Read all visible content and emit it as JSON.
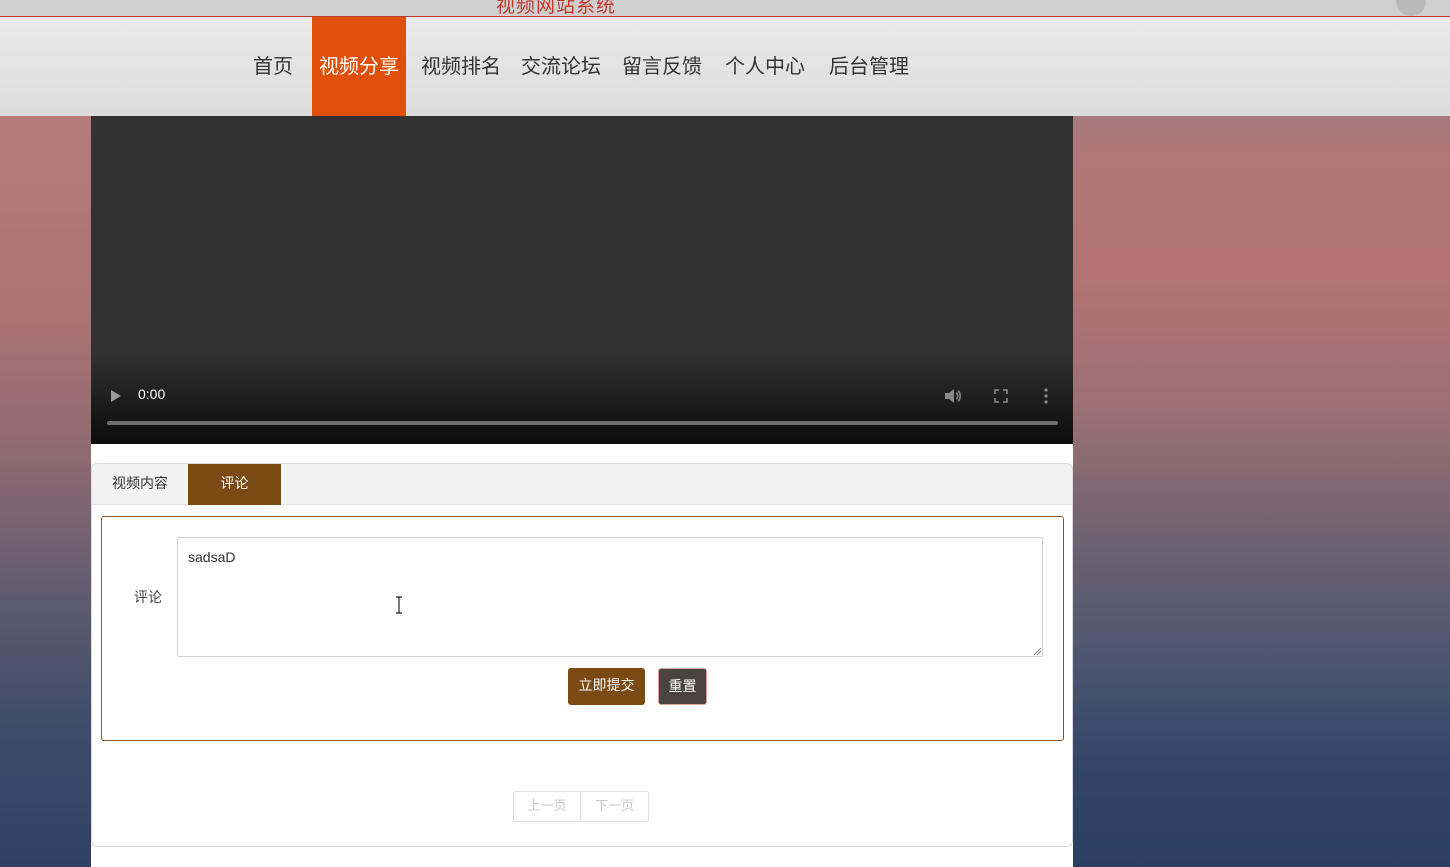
{
  "header": {
    "site_title": "视频网站系统"
  },
  "nav": {
    "items": [
      {
        "label": "首页",
        "active": false
      },
      {
        "label": "视频分享",
        "active": true
      },
      {
        "label": "视频排名",
        "active": false
      },
      {
        "label": "交流论坛",
        "active": false
      },
      {
        "label": "留言反馈",
        "active": false
      },
      {
        "label": "个人中心",
        "active": false
      },
      {
        "label": "后台管理",
        "active": false
      }
    ]
  },
  "video": {
    "current_time": "0:00",
    "icons": [
      "play-icon",
      "volume-icon",
      "fullscreen-icon",
      "more-options-icon"
    ]
  },
  "tabs": [
    {
      "label": "视频内容",
      "active": false
    },
    {
      "label": "评论",
      "active": true
    }
  ],
  "comment_form": {
    "label": "评论",
    "value": "sadsaD",
    "submit_label": "立即提交",
    "reset_label": "重置"
  },
  "pager": {
    "prev_label": "上一页",
    "next_label": "下一页"
  },
  "colors": {
    "nav_active": "#e0500b",
    "tab_active": "#7b4a14",
    "submit_button": "#7b4a14",
    "reset_button": "#4a4342",
    "title_red": "#c0392b"
  }
}
